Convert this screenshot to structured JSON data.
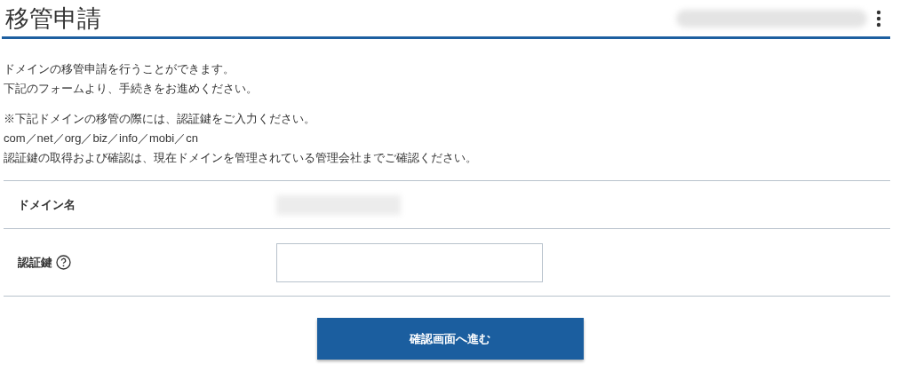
{
  "header": {
    "title": "移管申請"
  },
  "intro": [
    "ドメインの移管申請を行うことができます。",
    "下記のフォームより、手続きをお進めください。"
  ],
  "notes": [
    "※下記ドメインの移管の際には、認証鍵をご入力ください。",
    "com／net／org／biz／info／mobi／cn",
    "認証鍵の取得および確認は、現在ドメインを管理されている管理会社までご確認ください。"
  ],
  "form": [
    {
      "kind": "static",
      "label": "ドメイン名",
      "help": false
    },
    {
      "kind": "input",
      "label": "認証鍵",
      "help": true
    }
  ],
  "submit": {
    "label": "確認画面へ進む"
  }
}
